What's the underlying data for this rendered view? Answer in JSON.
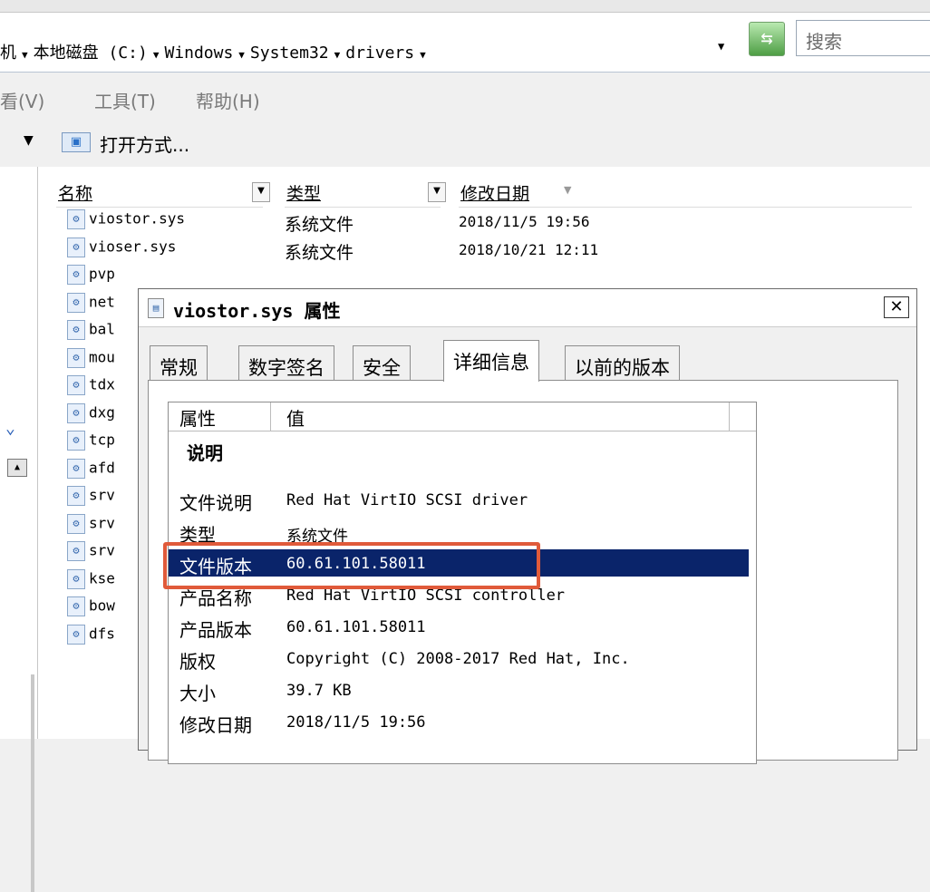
{
  "address": {
    "crumbs": [
      "机",
      "本地磁盘 (C:)",
      "Windows",
      "System32",
      "drivers"
    ],
    "search_placeholder": "搜索"
  },
  "menu": {
    "items": [
      "看(V)",
      "工具(T)",
      "帮助(H)"
    ]
  },
  "toolbar": {
    "open_with": "打开方式..."
  },
  "columns": {
    "name": "名称",
    "type": "类型",
    "modified": "修改日期"
  },
  "files": [
    {
      "name": "viostor.sys",
      "type": "系统文件",
      "date": "2018/11/5 19:56"
    },
    {
      "name": "vioser.sys",
      "type": "系统文件",
      "date": "2018/10/21 12:11"
    },
    {
      "name": "pvp"
    },
    {
      "name": "net"
    },
    {
      "name": "bal"
    },
    {
      "name": "mou"
    },
    {
      "name": "tdx"
    },
    {
      "name": "dxg"
    },
    {
      "name": "tcp"
    },
    {
      "name": "afd"
    },
    {
      "name": "srv"
    },
    {
      "name": "srv"
    },
    {
      "name": "srv"
    },
    {
      "name": "kse"
    },
    {
      "name": "bow"
    },
    {
      "name": "dfs"
    }
  ],
  "dialog": {
    "title": "viostor.sys 属性",
    "close_label": "✕",
    "tabs": [
      "常规",
      "数字签名",
      "安全",
      "详细信息",
      "以前的版本"
    ],
    "active_tab": "详细信息",
    "prop_header": "属性",
    "value_header": "值",
    "section": "说明",
    "rows": [
      {
        "name": "文件说明",
        "value": "Red Hat VirtIO SCSI driver"
      },
      {
        "name": "类型",
        "value": "系统文件"
      },
      {
        "name": "文件版本",
        "value": "60.61.101.58011"
      },
      {
        "name": "产品名称",
        "value": "Red Hat VirtIO SCSI controller"
      },
      {
        "name": "产品版本",
        "value": "60.61.101.58011"
      },
      {
        "name": "版权",
        "value": "Copyright (C) 2008-2017 Red Hat, Inc."
      },
      {
        "name": "大小",
        "value": "39.7 KB"
      },
      {
        "name": "修改日期",
        "value": "2018/11/5 19:56"
      }
    ],
    "selected_row": "文件版本"
  },
  "colors": {
    "selection": "#0a246a",
    "annotation": "#e05a3a"
  }
}
